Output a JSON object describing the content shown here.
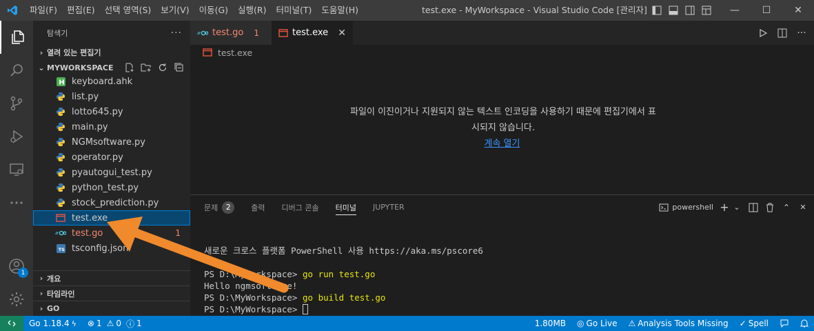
{
  "titlebar": {
    "menu": [
      "파일(F)",
      "편집(E)",
      "선택 영역(S)",
      "보기(V)",
      "이동(G)",
      "실행(R)",
      "터미널(T)",
      "도움말(H)"
    ],
    "title": "test.exe - MyWorkspace - Visual Studio Code [관리자]",
    "minimize": "—",
    "maximize": "☐",
    "close": "✕"
  },
  "activity": {
    "account_badge": "1"
  },
  "sidebar": {
    "title": "탐색기",
    "more": "···",
    "open_editors": "열려 있는 편집기",
    "workspace": "MYWORKSPACE",
    "files": [
      {
        "name": "keyboard.ahk",
        "icon": "ahk-icon"
      },
      {
        "name": "list.py",
        "icon": "python-icon"
      },
      {
        "name": "lotto645.py",
        "icon": "python-icon"
      },
      {
        "name": "main.py",
        "icon": "python-icon"
      },
      {
        "name": "NGMsoftware.py",
        "icon": "python-icon"
      },
      {
        "name": "operator.py",
        "icon": "python-icon"
      },
      {
        "name": "pyautogui_test.py",
        "icon": "python-icon"
      },
      {
        "name": "python_test.py",
        "icon": "python-icon"
      },
      {
        "name": "stock_prediction.py",
        "icon": "python-icon"
      },
      {
        "name": "test.exe",
        "icon": "binary-file-icon"
      },
      {
        "name": "test.go",
        "icon": "go-icon",
        "problems": "1"
      },
      {
        "name": "tsconfig.json",
        "icon": "tsconfig-icon"
      }
    ],
    "outline": "개요",
    "timeline": "타임라인",
    "go": "GO"
  },
  "tabs": [
    {
      "label": "test.go",
      "problems": "1"
    },
    {
      "label": "test.exe",
      "close": "✕"
    }
  ],
  "breadcrumb": "test.exe",
  "editor": {
    "message": "파일이 이진이거나 지원되지 않는 텍스트 인코딩을 사용하기 때문에 편집기에서 표시되지 않습니다.",
    "open_anyway": "계속 열기"
  },
  "panel": {
    "tabs": {
      "problems": "문제",
      "problems_count": "2",
      "output": "출력",
      "debug": "디버그 콘솔",
      "terminal": "터미널",
      "jupyter": "JUPYTER"
    },
    "shell": "powershell",
    "terminal": {
      "line1": "새로운 크로스 플랫폼 PowerShell 사용 https://aka.ms/pscore6",
      "prompt": "PS D:\\MyWorkspace> ",
      "cmd1": "go run test.go",
      "out1": "Hello ngmsoftware!",
      "cmd2": "go build test.go"
    }
  },
  "status": {
    "go_version": "Go 1.18.4",
    "errors": "1",
    "warnings": "0",
    "info": "1",
    "memory": "1.80MB",
    "go_live": "Go Live",
    "analysis": "Analysis Tools Missing",
    "spell": "Spell"
  },
  "colors": {
    "accent": "#007acc",
    "annotation_arrow": "#f08a2c",
    "error": "#f48771",
    "selection": "#094771"
  }
}
